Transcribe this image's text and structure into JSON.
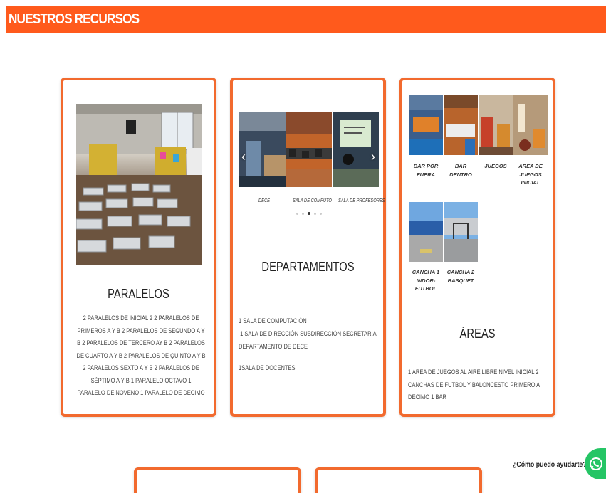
{
  "header": {
    "title": "NUESTROS RECURSOS"
  },
  "cards": {
    "paralelos": {
      "title": "PARALELOS",
      "text": "2 PARALELOS DE INICIAL 2 2 PARALELOS DE PRIMEROS A Y B 2 PARALELOS DE SEGUNDO A Y B 2 PARALELOS DE TERCERO AY B 2 PARALELOS DE CUARTO A Y B 2 PARALELOS DE QUINTO A Y B 2 PARALELOS SEXTO A Y B 2 PARALELOS DE SÉPTIMO A Y B 1 PARALELO OCTAVO 1 PARALELO DE NOVENO 1 PARALELO DE DECIMO"
    },
    "departamentos": {
      "captions": [
        "DECE",
        "SALA DE COMPUTO",
        "SALA DE PROFESORES"
      ],
      "active_slide": 3,
      "slide_count": 5,
      "title": "DEPARTAMENTOS",
      "lines": [
        "1 SALA DE COMPUTACIÓN",
        " 1 SALA DE DIRECCIÓN SUBDIRECCIÓN SECRETARIA",
        "DEPARTAMENTO DE DECE",
        "1SALA DE DOCENTES"
      ]
    },
    "areas": {
      "items": [
        {
          "caption": "BAR POR FUERA"
        },
        {
          "caption": "BAR DENTRO"
        },
        {
          "caption": "JUEGOS"
        },
        {
          "caption": "AREA DE JUEGOS INICIAL"
        },
        {
          "caption": "CANCHA 1 INDOR-FUTBOL"
        },
        {
          "caption": "CANCHA 2 BASQUET"
        }
      ],
      "title": "ÁREAS",
      "text": "1 AREA DE JUEGOS AL AIRE LIBRE NIVEL INICIAL 2 CANCHAS DE FUTBOL Y BALONCESTO PRIMERO A DECIMO 1 BAR"
    }
  },
  "whatsapp": {
    "label": "¿Cómo puedo ayudarte?",
    "icon": "whatsapp-icon",
    "color": "#25c565"
  },
  "colors": {
    "accent": "#ff5a1c",
    "card_border": "#f26a2e"
  }
}
